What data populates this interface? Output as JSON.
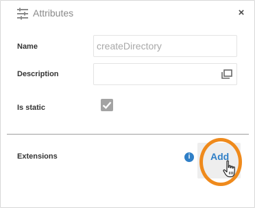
{
  "header": {
    "icon": "sliders-icon",
    "title": "Attributes",
    "close_label": "×"
  },
  "form": {
    "name_label": "Name",
    "name_value": "createDirectory",
    "description_label": "Description",
    "description_value": "",
    "is_static_label": "Is static",
    "is_static_checked": true
  },
  "extensions": {
    "label": "Extensions",
    "info_glyph": "i",
    "add_label": "Add"
  },
  "colors": {
    "accent": "#2f7fc7",
    "highlight": "#ef8a1c",
    "checkbox": "#a3a3a3"
  }
}
